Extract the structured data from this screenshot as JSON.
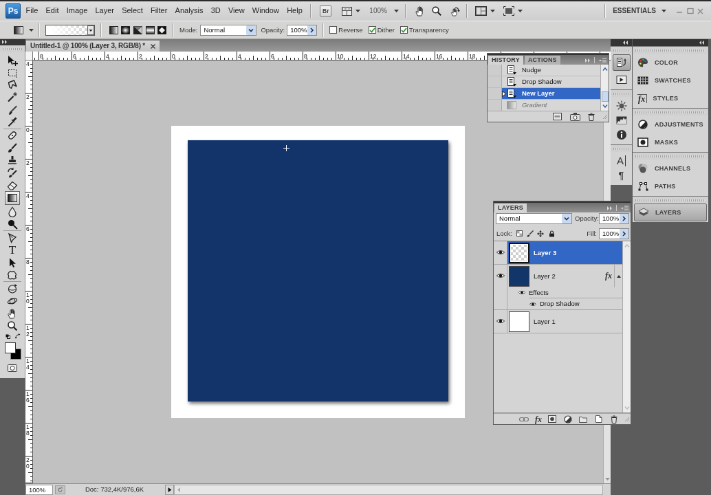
{
  "menu_bar": {
    "logo": "Ps",
    "menus": [
      "File",
      "Edit",
      "Image",
      "Layer",
      "Select",
      "Filter",
      "Analysis",
      "3D",
      "View",
      "Window",
      "Help"
    ],
    "bridge": "Br",
    "zoom": "100%",
    "workspace": "ESSENTIALS"
  },
  "options_bar": {
    "mode_label": "Mode:",
    "mode": "Normal",
    "opacity_label": "Opacity:",
    "opacity": "100%",
    "checkboxes": [
      {
        "label": "Reverse",
        "checked": false
      },
      {
        "label": "Dither",
        "checked": true
      },
      {
        "label": "Transparency",
        "checked": true
      }
    ]
  },
  "toolbox": {
    "groups": [
      [
        {
          "kind": "move",
          "selected": false
        },
        {
          "kind": "marquee",
          "selected": false
        },
        {
          "kind": "lasso",
          "selected": false
        },
        {
          "kind": "wand",
          "selected": false
        },
        {
          "kind": "slice",
          "selected": false
        },
        {
          "kind": "eyedropper",
          "selected": false
        }
      ],
      [
        {
          "kind": "healing",
          "selected": false
        },
        {
          "kind": "brush",
          "selected": false
        },
        {
          "kind": "stamp",
          "selected": false
        },
        {
          "kind": "history_brush",
          "selected": false
        },
        {
          "kind": "eraser",
          "selected": false
        },
        {
          "kind": "gradient",
          "selected": true
        },
        {
          "kind": "blur",
          "selected": false
        },
        {
          "kind": "dodge",
          "selected": false
        }
      ],
      [
        {
          "kind": "pen",
          "selected": false
        },
        {
          "kind": "type",
          "label": "T",
          "selected": false
        },
        {
          "kind": "path_select",
          "selected": false
        },
        {
          "kind": "shape",
          "selected": false
        }
      ],
      [
        {
          "kind": "rotate3d",
          "selected": false
        },
        {
          "kind": "orbit3d",
          "selected": false
        },
        {
          "kind": "hand",
          "selected": false
        },
        {
          "kind": "zoom",
          "selected": false
        }
      ]
    ]
  },
  "document": {
    "tab": "Untitled-1 @ 100% (Layer 3, RGB/8) *",
    "ruler_horizontal": [
      "8",
      "6",
      "4",
      "2",
      "0",
      "2",
      "4",
      "6",
      "8",
      "10",
      "12",
      "14",
      "16",
      "18"
    ],
    "ruler_vertical": [
      "4",
      "2",
      "0",
      "2",
      "4",
      "6",
      "8",
      "10",
      "12",
      "14",
      "16",
      "18",
      "20"
    ],
    "zoom": "100%",
    "info": "Doc: 732,4K/976,6K"
  },
  "history": {
    "tabs": [
      {
        "label": "HISTORY",
        "selected": true
      },
      {
        "label": "ACTIONS",
        "selected": false
      }
    ],
    "states": [
      {
        "label": "Nudge",
        "kind": "step",
        "selected": false,
        "undone": false
      },
      {
        "label": "Drop Shadow",
        "kind": "step",
        "selected": false,
        "undone": false
      },
      {
        "label": "New Layer",
        "kind": "step",
        "selected": true,
        "undone": false
      },
      {
        "label": "Gradient",
        "kind": "gradient",
        "selected": false,
        "undone": true
      }
    ]
  },
  "dock": {
    "icons": [
      [
        {
          "kind": "history",
          "selected": true
        },
        {
          "kind": "actions",
          "selected": false
        }
      ],
      [
        {
          "kind": "navigator",
          "selected": false
        },
        {
          "kind": "histogram",
          "selected": false
        },
        {
          "kind": "info",
          "selected": false
        }
      ],
      [
        {
          "kind": "character",
          "label": "A",
          "selected": false
        },
        {
          "kind": "paragraph",
          "label": "¶",
          "selected": false
        }
      ]
    ],
    "panels": [
      [
        {
          "kind": "color",
          "label": "COLOR",
          "selected": false
        },
        {
          "kind": "swatches",
          "label": "SWATCHES",
          "selected": false
        },
        {
          "kind": "styles",
          "label": "STYLES",
          "icon_text": "fx",
          "selected": false
        }
      ],
      [
        {
          "kind": "adjustments",
          "label": "ADJUSTMENTS",
          "selected": false
        },
        {
          "kind": "masks",
          "label": "MASKS",
          "selected": false
        }
      ],
      [
        {
          "kind": "channels",
          "label": "CHANNELS",
          "selected": false
        },
        {
          "kind": "paths",
          "label": "PATHS",
          "selected": false
        }
      ],
      [
        {
          "kind": "layers",
          "label": "LAYERS",
          "selected": true
        }
      ]
    ]
  },
  "layers": {
    "tabs": [
      {
        "label": "LAYERS",
        "selected": true
      }
    ],
    "blend_mode": "Normal",
    "opacity_label": "Opacity:",
    "opacity": "100%",
    "lock_label": "Lock:",
    "fill_label": "Fill:",
    "fill": "100%",
    "items": [
      {
        "name": "Layer 3",
        "transparent": true,
        "visible": true,
        "selected": true
      },
      {
        "name": "Layer 2",
        "transparent": false,
        "color": "#12356a",
        "visible": true,
        "selected": false,
        "fx": "fx",
        "expanded": true,
        "effects": {
          "label": "Effects",
          "visible": true,
          "items": [
            {
              "label": "Drop Shadow",
              "visible": true
            }
          ]
        }
      },
      {
        "name": "Layer 1",
        "transparent": false,
        "color": "#ffffff",
        "visible": true,
        "selected": false
      }
    ],
    "footer_fx": "fx"
  }
}
